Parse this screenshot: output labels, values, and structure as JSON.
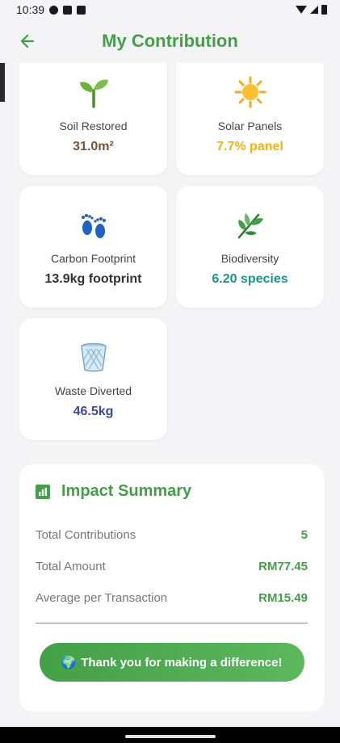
{
  "status_bar": {
    "time": "10:39"
  },
  "app_bar": {
    "title": "My Contribution"
  },
  "metrics": [
    {
      "label": "Soil Restored",
      "value": "31.0m²",
      "icon": "seedling-icon",
      "color": "#7b5436"
    },
    {
      "label": "Solar Panels",
      "value": "7.7% panel",
      "icon": "sun-icon",
      "color": "#f4b400"
    },
    {
      "label": "Carbon Footprint",
      "value": "13.9kg footprint",
      "icon": "footprints-icon",
      "color": "#333333"
    },
    {
      "label": "Biodiversity",
      "value": "6.20 species",
      "icon": "leaf-icon",
      "color": "#17968a"
    },
    {
      "label": "Waste Diverted",
      "value": "46.5kg",
      "icon": "wastebasket-icon",
      "color": "#3949ab"
    }
  ],
  "summary": {
    "title": "Impact Summary",
    "rows": [
      {
        "label": "Total Contributions",
        "value": "5"
      },
      {
        "label": "Total Amount",
        "value": "RM77.45"
      },
      {
        "label": "Average per Transaction",
        "value": "RM15.49"
      }
    ],
    "button": {
      "emoji": "🌍",
      "text": "Thank you for making a difference!"
    }
  },
  "colors": {
    "accent": "#43a047",
    "background": "#f4f4f6"
  }
}
